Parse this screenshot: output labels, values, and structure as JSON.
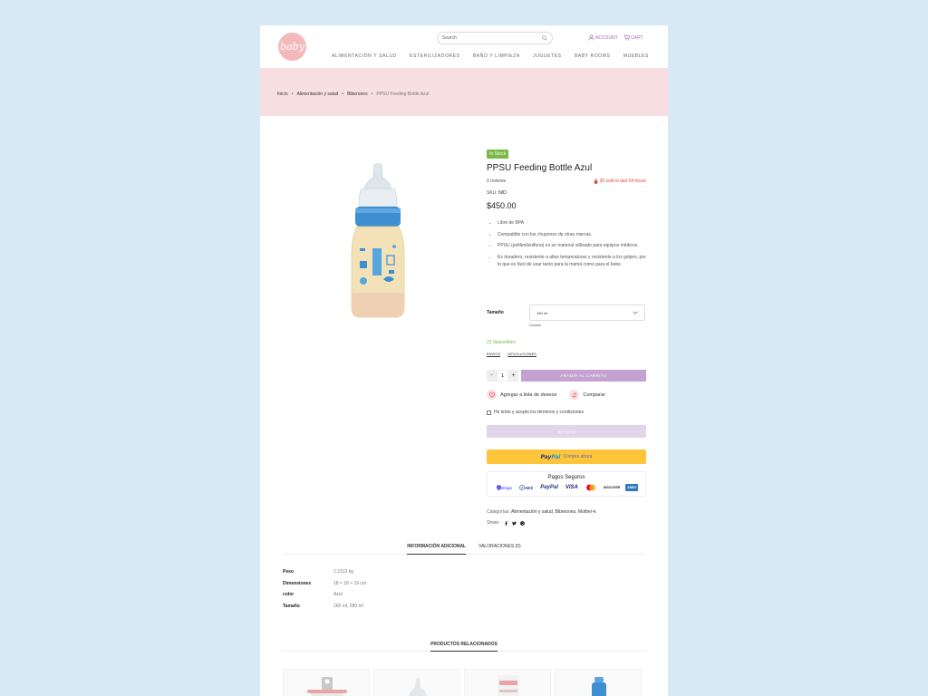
{
  "brand": {
    "logo_text": "baby"
  },
  "header": {
    "search_placeholder": "Search",
    "account_label": "ACCOUNT",
    "cart_label": "CART"
  },
  "nav": [
    "ALIMENTACIÓN Y SALUD",
    "ESTERILIZADORES",
    "BAÑO Y LIMPIEZA",
    "JUGUETES",
    "BABY ROOMS",
    "MUEBLES"
  ],
  "breadcrumb": [
    "Inicio",
    "Alimentación y salud",
    "Biberones",
    "PPSU Feeding Bottle Azul"
  ],
  "product": {
    "stock_badge": "In Stock",
    "title": "PPSU Feeding Bottle Azul",
    "reviews": "0 reviews",
    "sold_text": "35 sold in last 04 hours",
    "sku_label": "SKU:",
    "sku_value": "N/D",
    "price": "$450.00",
    "features": [
      "Libre de BPA",
      "Compatible con los chupones de otras marcas.",
      "PPSU (polifenilsulfona) es un material utilizado para equipos médicos.",
      "Es duradero, resistente a altas temperaturas y resistente a los golpes, por lo que es fácil de usar tanto para la mamá como para el bebe."
    ],
    "size_label": "Tamaño",
    "size_value": "160 ml",
    "clear_label": "Limpiar",
    "availability": "22 disponibles",
    "links": [
      "ENVÍOS",
      "DEVOLUCIONES"
    ],
    "qty": "1",
    "add_to_cart": "AÑADIR AL CARRITO",
    "wishlist": "Agregar a lista de deseos",
    "compare": "Comparar",
    "terms": "He leído y acepto los términos y condiciones",
    "buy_now": "BUY NOW",
    "paypal_word_1": "Pay",
    "paypal_word_2": "Pal",
    "paypal_sub": "Compra ahora",
    "secure_title": "Pagos Seguros",
    "secure_logos": [
      "stripe",
      "AES",
      "PayPal",
      "VISA",
      "MC",
      "DISCOVER",
      "AMEX"
    ],
    "categories_label": "Categorías:",
    "categories_value": "Alimentación y salud, Biberones, Mother-k",
    "share_label": "Share:"
  },
  "tabs": [
    "INFORMACIÓN ADICIONAL",
    "VALORACIONES (0)"
  ],
  "specs": [
    {
      "k": "Peso",
      "v": "1.2312 kg"
    },
    {
      "k": "Dimensiones",
      "v": "18 × 18 × 19 cm"
    },
    {
      "k": "color",
      "v": "Azul"
    },
    {
      "k": "Tamaño",
      "v": "160 ml, 280 ml"
    }
  ],
  "related_title": "PRODUCTOS RELACIONADOS",
  "colors": {
    "accent": "#a56bb6",
    "band": "#f8dfe1",
    "stock": "#7ab84a",
    "sold": "#e2413f",
    "paypal": "#ffc43a"
  }
}
